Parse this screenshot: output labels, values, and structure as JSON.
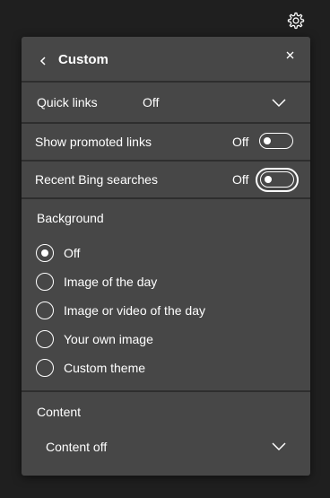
{
  "panel": {
    "title": "Custom",
    "back_icon": "chevron-left-icon",
    "close_icon": "close-icon",
    "settings_icon": "gear-icon"
  },
  "quick_links": {
    "label": "Quick links",
    "value": "Off"
  },
  "promoted_links": {
    "label": "Show promoted links",
    "state": "Off"
  },
  "bing_searches": {
    "label": "Recent Bing searches",
    "state": "Off"
  },
  "background": {
    "heading": "Background",
    "selected": "Off",
    "options": [
      "Off",
      "Image of the day",
      "Image or video of the day",
      "Your own image",
      "Custom theme"
    ]
  },
  "content": {
    "heading": "Content",
    "value": "Content off"
  },
  "colors": {
    "page_bg": "#1f1f1f",
    "panel_bg": "#474747",
    "divider": "#2e2e2e",
    "text": "#ffffff"
  }
}
